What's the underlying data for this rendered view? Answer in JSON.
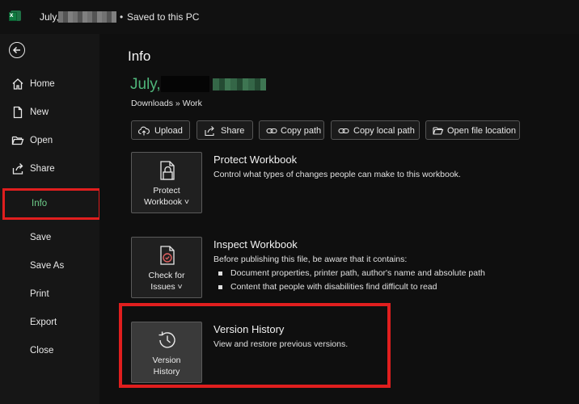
{
  "titlebar": {
    "doc_name": "July,",
    "separator": "•",
    "status": "Saved to this PC"
  },
  "nav": {
    "items": [
      {
        "label": "Home",
        "icon": "home-icon"
      },
      {
        "label": "New",
        "icon": "new-document-icon"
      },
      {
        "label": "Open",
        "icon": "folder-open-icon"
      },
      {
        "label": "Share",
        "icon": "share-icon"
      },
      {
        "label": "Info",
        "icon": "",
        "active": true
      },
      {
        "label": "Save"
      },
      {
        "label": "Save As"
      },
      {
        "label": "Print"
      },
      {
        "label": "Export"
      },
      {
        "label": "Close"
      }
    ]
  },
  "main": {
    "title": "Info",
    "doc_name": "July,",
    "breadcrumb": "Downloads » Work",
    "actions": [
      {
        "label": "Upload",
        "icon": "upload-cloud-icon"
      },
      {
        "label": "Share",
        "icon": "share-icon"
      },
      {
        "label": "Copy path",
        "icon": "link-icon"
      },
      {
        "label": "Copy local path",
        "icon": "link-icon"
      },
      {
        "label": "Open file location",
        "icon": "folder-open-icon"
      }
    ],
    "protect": {
      "button_line1": "Protect",
      "button_line2": "Workbook ˅",
      "title": "Protect Workbook",
      "description": "Control what types of changes people can make to this workbook."
    },
    "inspect": {
      "button_line1": "Check for",
      "button_line2": "Issues ˅",
      "title": "Inspect Workbook",
      "description": "Before publishing this file, be aware that it contains:",
      "bullets": [
        "Document properties, printer path, author's name and absolute path",
        "Content that people with disabilities find difficult to read"
      ]
    },
    "version": {
      "button_line1": "Version",
      "button_line2": "History",
      "title": "Version History",
      "description": "View and restore previous versions."
    }
  },
  "colors": {
    "accent_green": "#4fb57a",
    "highlight_red": "#e01e1e",
    "background": "#0f0f0f"
  }
}
